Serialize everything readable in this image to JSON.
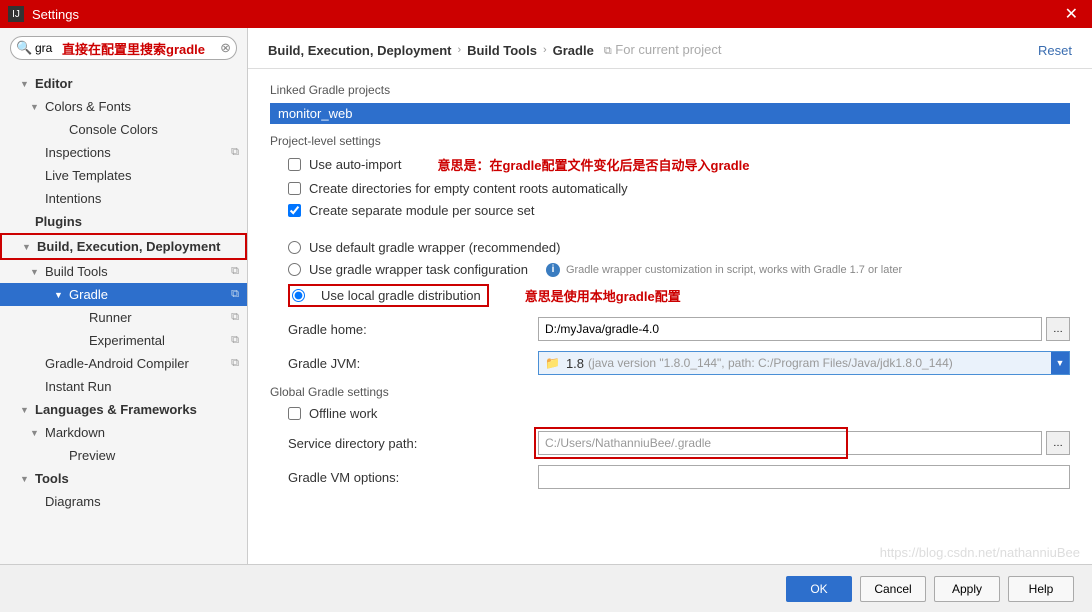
{
  "window": {
    "title": "Settings"
  },
  "search": {
    "value": "gra",
    "note": "直接在配置里搜索gradle"
  },
  "tree": {
    "editor": "Editor",
    "colors_fonts": "Colors & Fonts",
    "console_colors": "Console Colors",
    "inspections": "Inspections",
    "live_templates": "Live Templates",
    "intentions": "Intentions",
    "plugins": "Plugins",
    "bed": "Build, Execution, Deployment",
    "build_tools": "Build Tools",
    "gradle": "Gradle",
    "runner": "Runner",
    "experimental": "Experimental",
    "gradle_android": "Gradle-Android Compiler",
    "instant_run": "Instant Run",
    "lang_fw": "Languages & Frameworks",
    "markdown": "Markdown",
    "preview": "Preview",
    "tools": "Tools",
    "diagrams": "Diagrams"
  },
  "breadcrumb": {
    "a": "Build, Execution, Deployment",
    "b": "Build Tools",
    "c": "Gradle",
    "hint": "For current project",
    "reset": "Reset"
  },
  "content": {
    "linked_label": "Linked Gradle projects",
    "project": "monitor_web",
    "pls_label": "Project-level settings",
    "auto_import": "Use auto-import",
    "ann1": "意思是：在gradle配置文件变化后是否自动导入gradle",
    "create_dirs": "Create directories for empty content roots automatically",
    "create_module": "Create separate module per source set",
    "use_default": "Use default gradle wrapper (recommended)",
    "use_task": "Use gradle wrapper task configuration",
    "wrapper_info": "Gradle wrapper customization in script, works with Gradle 1.7 or later",
    "use_local": "Use local gradle distribution",
    "ann2": "意思是使用本地gradle配置",
    "gradle_home_label": "Gradle home:",
    "gradle_home_value": "D:/myJava/gradle-4.0",
    "gradle_jvm_label": "Gradle JVM:",
    "jvm_ver": "1.8",
    "jvm_detail": "(java version \"1.8.0_144\", path: C:/Program Files/Java/jdk1.8.0_144)",
    "global_label": "Global Gradle settings",
    "offline": "Offline work",
    "service_label": "Service directory path:",
    "service_value": "C:/Users/NathanniuBee/.gradle",
    "vm_options_label": "Gradle VM options:"
  },
  "footer": {
    "ok": "OK",
    "cancel": "Cancel",
    "apply": "Apply",
    "help": "Help"
  },
  "watermark": "https://blog.csdn.net/nathanniuBee"
}
